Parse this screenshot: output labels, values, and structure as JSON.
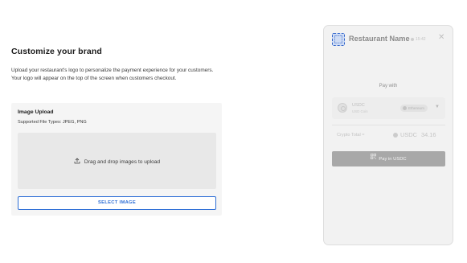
{
  "brand": {
    "title": "Customize your brand",
    "description": "Upload your restaurant's logo to personalize the payment experience for your customers. Your logo will appear on the top of the screen when customers checkout."
  },
  "upload": {
    "title": "Image Upload",
    "supported_types": "Supported File Types: JPEG, PNG",
    "dropzone_text": "Drag and drop images to upload",
    "select_button": "SELECT IMAGE"
  },
  "preview": {
    "restaurant_name": "Restaurant Name",
    "timer": "15:42",
    "close_symbol": "✕",
    "pay_with_label": "Pay with",
    "coin": {
      "symbol": "USDC",
      "name": "USD Coin",
      "network": "Ethereum"
    },
    "crypto_total_label": "Crypto Total ≈",
    "total_currency": "USDC",
    "total_amount": "34.16",
    "pay_button": "Pay in USDC"
  },
  "colors": {
    "accent_blue": "#2f6fd6",
    "preview_bg": "#f2f2f2",
    "pay_button_bg": "#a8a8a8"
  }
}
